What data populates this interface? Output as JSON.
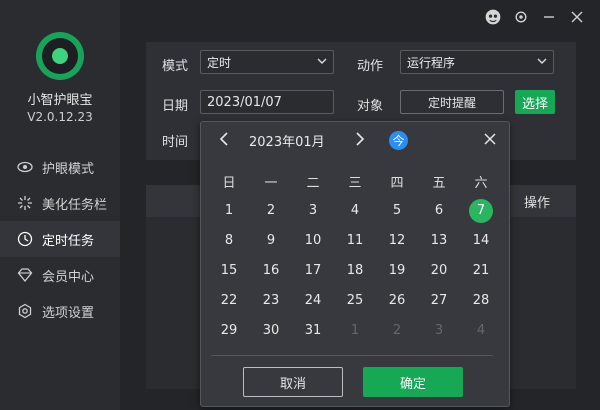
{
  "app": {
    "name": "小智护眼宝",
    "version": "V2.0.12.23"
  },
  "window_controls": {
    "skin_icon": "avatar-skin-icon",
    "settings": "gear-icon",
    "minimize": "minimize-icon",
    "close": "close-icon"
  },
  "sidebar": {
    "items": [
      {
        "label": "护眼模式",
        "icon": "eye-icon"
      },
      {
        "label": "美化任务栏",
        "icon": "sparkle-icon"
      },
      {
        "label": "定时任务",
        "icon": "clock-icon",
        "active": true
      },
      {
        "label": "会员中心",
        "icon": "diamond-icon"
      },
      {
        "label": "选项设置",
        "icon": "gear-icon"
      }
    ]
  },
  "form": {
    "mode_label": "模式",
    "mode_value": "定时",
    "action_label": "动作",
    "action_value": "运行程序",
    "date_label": "日期",
    "date_value": "2023/01/07",
    "target_label": "对象",
    "target_value": "定时提醒",
    "choose_label": "选择",
    "time_label": "时间"
  },
  "table": {
    "op_header": "操作"
  },
  "calendar": {
    "title": "2023年01月",
    "today_label": "今",
    "weekdays": [
      "日",
      "一",
      "二",
      "三",
      "四",
      "五",
      "六"
    ],
    "weeks": [
      [
        " ",
        "1",
        "2",
        "3",
        "4",
        "5",
        "6",
        "7"
      ],
      [
        "8",
        "9",
        "10",
        "11",
        "12",
        "13",
        "14"
      ],
      [
        "15",
        "16",
        "17",
        "18",
        "19",
        "20",
        "21"
      ],
      [
        "22",
        "23",
        "24",
        "25",
        "26",
        "27",
        "28"
      ],
      [
        "29",
        "30",
        "31",
        "1",
        "2",
        "3",
        "4"
      ]
    ],
    "selected_day": "7",
    "cancel_label": "取消",
    "ok_label": "确定"
  },
  "colors": {
    "accent_green": "#16a855",
    "today_blue": "#2b8ef0"
  }
}
